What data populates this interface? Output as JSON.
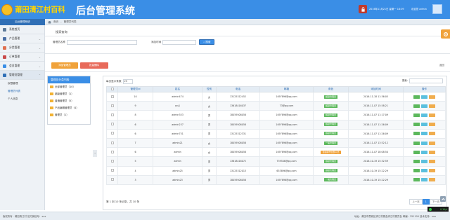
{
  "header": {
    "logo_text": "莆田清江村百科",
    "system_title": "后台管理系统",
    "datetime": "2016年11月21日 星期一 18:09",
    "user": "欢迎您 admin"
  },
  "breadcrumb": {
    "items": [
      "首页",
      "管理员列表"
    ]
  },
  "sidebar": {
    "header": "后台管理系统",
    "items": [
      {
        "label": "系统首页"
      },
      {
        "label": "产品管理"
      },
      {
        "label": "分类管理"
      },
      {
        "label": "订单管理"
      },
      {
        "label": "会员管理"
      },
      {
        "label": "管理员管理",
        "active": true
      }
    ],
    "sub_items": [
      {
        "label": "权限管理"
      },
      {
        "label": "管理员列表",
        "current": true
      },
      {
        "label": "个人信息"
      }
    ]
  },
  "search": {
    "title": "搜索查询",
    "name_label": "管理员名称",
    "name_value": "",
    "date_label": "添加时间",
    "date_value": "",
    "button": "搜索"
  },
  "actions": {
    "add": "添加管理员",
    "delete": "批量删除",
    "back": "返回"
  },
  "group_panel": {
    "title": "管理员分类列表",
    "groups": [
      "全部管理员（10）",
      "超级管理员（1）",
      "普通管理员（5）",
      "产品编辑管理员（4）",
      "管理员（1）"
    ]
  },
  "table": {
    "page_size_label": "每页显示条数",
    "page_size": "25",
    "search_label": "搜索:",
    "columns": [
      "",
      "管理员id",
      "姓名",
      "性别",
      "电话",
      "邮箱",
      "角色",
      "添加时间",
      "操作"
    ],
    "rows": [
      {
        "id": "10",
        "name": "admin474",
        "sex": "女",
        "phone": "13125312452",
        "email": "1097896@qq.com",
        "role": "超级管理员",
        "role_open": false,
        "time": "2016-11-18 11:36:05"
      },
      {
        "id": "9",
        "name": "css1",
        "sex": "女",
        "phone": "13618416037",
        "email": "73@qq.com",
        "role": "超级管理员",
        "role_open": false,
        "time": "2016-11-07 15:58:21"
      },
      {
        "id": "8",
        "name": "admin353",
        "sex": "男",
        "phone": "18059508058",
        "email": "1097896@qq.com",
        "role": "超级管理员",
        "role_open": false,
        "time": "2016-11-07 11:17:09"
      },
      {
        "id": "6",
        "name": "admin237",
        "sex": "男",
        "phone": "18059508058",
        "email": "1097896@qq.com",
        "role": "超级管理员",
        "role_open": false,
        "time": "2016-11-07 11:26:09"
      },
      {
        "id": "6",
        "name": "admin751",
        "sex": "男",
        "phone": "13125312331",
        "email": "1097896@qq.com",
        "role": "超级管理员",
        "role_open": false,
        "time": "2016-11-07 11:26:09"
      },
      {
        "id": "7",
        "name": "admin21",
        "sex": "女",
        "phone": "18059508058",
        "email": "1097896@qq.com",
        "role": "一般管理员",
        "role_open": false,
        "time": "2016-11-07 13:52:12"
      },
      {
        "id": "6",
        "name": "admin",
        "sex": "女",
        "phone": "18059508058",
        "email": "1097896@qq.com",
        "role": "自由操作全部人员",
        "role_open": true,
        "time": "2016-11-07 18:08:50"
      },
      {
        "id": "5",
        "name": "admin",
        "sex": "男",
        "phone": "13618416072",
        "email": "739546@qq.com",
        "role": "超级管理员",
        "role_open": false,
        "time": "2016-10-19 15:32:59"
      },
      {
        "id": "4",
        "name": "admin25",
        "sex": "男",
        "phone": "13125312013",
        "email": "653896@qq.com",
        "role": "超级管理员",
        "role_open": false,
        "time": "2016-10-19 15:22:29"
      },
      {
        "id": "3",
        "name": "admin23",
        "sex": "男",
        "phone": "18059508058",
        "email": "1097896@qq.com",
        "role": "一般管理员",
        "role_open": false,
        "time": "2016-10-19 15:22:29"
      }
    ],
    "info": "第 1 到 10 条记录，共 10 条",
    "pager": {
      "prev": "上一页",
      "page": "1",
      "next": "下一页"
    }
  },
  "footer": {
    "left": "版权所有：莆田清江村 官方微信号：xxx",
    "right": "地址：莆田市荔城区清江村委会清江村委员会 邮编：351100 技术支持：xxx"
  },
  "net_badge": "0.1K/s",
  "colors": {
    "primary": "#3a8ee6",
    "header_bar": "#2f6fb6",
    "orange": "#f0a23a",
    "red": "#e86a5a",
    "green": "#5cb85c"
  }
}
